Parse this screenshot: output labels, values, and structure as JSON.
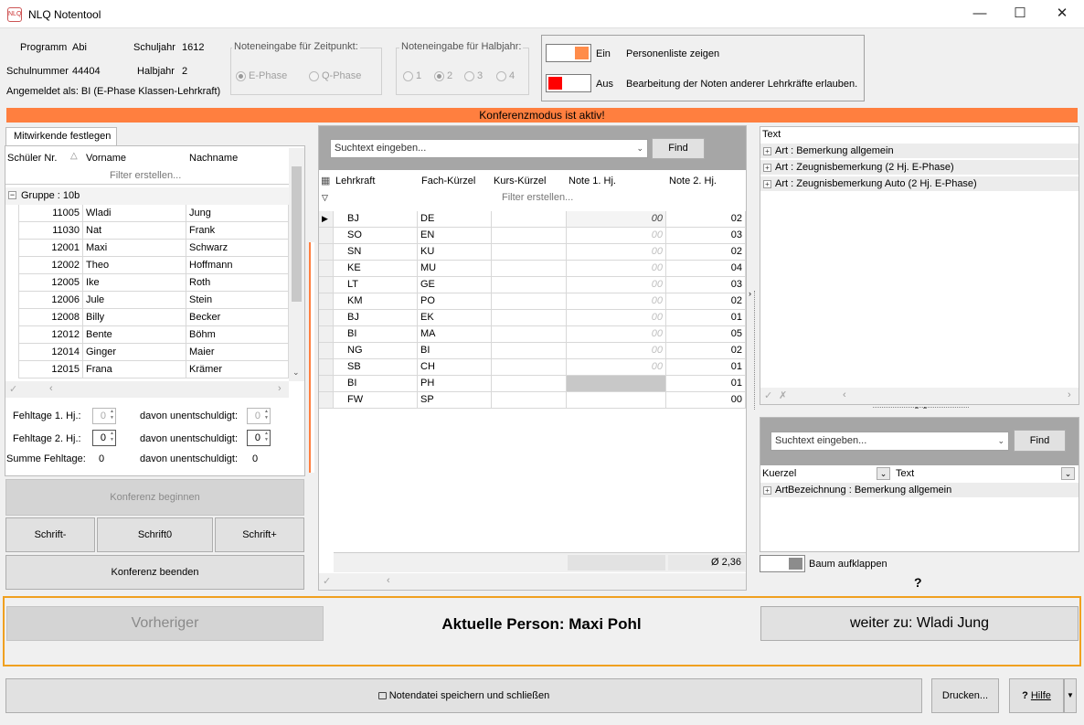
{
  "window": {
    "title": "NLQ Notentool",
    "app_icon": "NLQ",
    "min": "—",
    "max": "☐",
    "close": "✕"
  },
  "info": {
    "programm_label": "Programm",
    "programm_value": "Abi",
    "schuljahr_label": "Schuljahr",
    "schuljahr_value": "1612",
    "schulnummer_label": "Schulnummer",
    "schulnummer_value": "44404",
    "halbjahr_label": "Halbjahr",
    "halbjahr_value": "2",
    "angemeldet": "Angemeldet als: BI (E-Phase Klassen-Lehrkraft)"
  },
  "zeitpunkt": {
    "title": "Noteneingabe für Zeitpunkt:",
    "opt1": "E-Phase",
    "opt2": "Q-Phase"
  },
  "halbjahr_group": {
    "title": "Noteneingabe für Halbjahr:",
    "options": [
      "1",
      "2",
      "3",
      "4"
    ]
  },
  "toggles": {
    "personen_state": "Ein",
    "personen_text": "Personenliste zeigen",
    "personen_color": "#ff8c4a",
    "bearb_state": "Aus",
    "bearb_text": "Bearbeitung der Noten anderer Lehrkräfte erlauben.",
    "bearb_color": "#ff0000"
  },
  "banner": "Konferenzmodus ist aktiv!",
  "left": {
    "tab": "Mitwirkende festlegen",
    "col_nr": "Schüler Nr.",
    "col_vorname": "Vorname",
    "col_nachname": "Nachname",
    "filter": "Filter erstellen...",
    "group": "Gruppe : 10b",
    "students": [
      [
        "11005",
        "Wladi",
        "Jung"
      ],
      [
        "11030",
        "Nat",
        "Frank"
      ],
      [
        "12001",
        "Maxi",
        "Schwarz"
      ],
      [
        "12002",
        "Theo",
        "Hoffmann"
      ],
      [
        "12005",
        "Ike",
        "Roth"
      ],
      [
        "12006",
        "Jule",
        "Stein"
      ],
      [
        "12008",
        "Billy",
        "Becker"
      ],
      [
        "12012",
        "Bente",
        "Böhm"
      ],
      [
        "12014",
        "Ginger",
        "Maier"
      ],
      [
        "12015",
        "Frana",
        "Krämer"
      ]
    ],
    "fehl1_label": "Fehltage 1. Hj.:",
    "fehl1_value": "0",
    "fehl1_unent_label": "davon unentschuldigt:",
    "fehl1_unent_value": "0",
    "fehl2_label": "Fehltage 2. Hj.:",
    "fehl2_value": "0",
    "fehl2_unent_label": "davon unentschuldigt:",
    "fehl2_unent_value": "0",
    "summe_label": "Summe Fehltage:",
    "summe_value": "0",
    "summe_unent_label": "davon unentschuldigt:",
    "summe_unent_value": "0",
    "btn_begin": "Konferenz beginnen",
    "btn_minus": "Schrift-",
    "btn_zero": "Schrift0",
    "btn_plus": "Schrift+",
    "btn_end": "Konferenz beenden"
  },
  "middle": {
    "search_placeholder": "Suchtext eingeben...",
    "find": "Find",
    "col_lehrkraft": "Lehrkraft",
    "col_fach": "Fach-Kürzel",
    "col_kurs": "Kurs-Kürzel",
    "col_note1": "Note 1. Hj.",
    "col_note2": "Note 2. Hj.",
    "filter": "Filter erstellen...",
    "rows": [
      [
        "BJ",
        "DE",
        "",
        "00",
        "02"
      ],
      [
        "SO",
        "EN",
        "",
        "00",
        "03"
      ],
      [
        "SN",
        "KU",
        "",
        "00",
        "02"
      ],
      [
        "KE",
        "MU",
        "",
        "00",
        "04"
      ],
      [
        "LT",
        "GE",
        "",
        "00",
        "03"
      ],
      [
        "KM",
        "PO",
        "",
        "00",
        "02"
      ],
      [
        "BJ",
        "EK",
        "",
        "00",
        "01"
      ],
      [
        "BI",
        "MA",
        "",
        "00",
        "05"
      ],
      [
        "NG",
        "BI",
        "",
        "00",
        "02"
      ],
      [
        "SB",
        "CH",
        "",
        "00",
        "01"
      ],
      [
        "BI",
        "PH",
        "",
        "",
        "01"
      ],
      [
        "FW",
        "SP",
        "",
        "",
        "00"
      ]
    ],
    "average": "Ø 2,36"
  },
  "right": {
    "header": "Text",
    "items": [
      "Art : Bemerkung allgemein",
      "Art : Zeugnisbemerkung (2 Hj. E-Phase)",
      "Art : Zeugnisbemerkung Auto (2 Hj. E-Phase)"
    ],
    "search_placeholder": "Suchtext eingeben...",
    "find": "Find",
    "col_kuerzel": "Kuerzel",
    "col_text": "Text",
    "bottom_item": "ArtBezeichnung : Bemerkung allgemein",
    "baum": "Baum aufklappen",
    "help_glyph": "?"
  },
  "nav": {
    "prev": "Vorheriger",
    "current": "Aktuelle Person: Maxi Pohl",
    "next": "weiter zu: Wladi Jung"
  },
  "footer": {
    "save": "Notendatei speichern und schließen",
    "print": "Drucken...",
    "help": "Hilfe"
  }
}
